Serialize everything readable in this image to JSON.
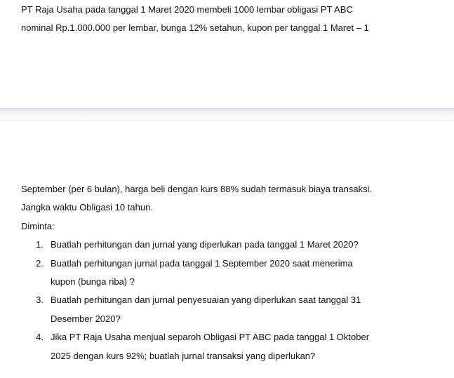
{
  "page1": {
    "line1": "PT Raja Usaha pada tanggal 1 Maret 2020 membeli 1000 lembar obligasi PT ABC",
    "line2": "nominal Rp.1.000.000 per lembar, bunga 12% setahun, kupon per tanggal 1 Maret – 1"
  },
  "page2": {
    "line1": "September (per 6 bulan), harga beli dengan kurs 88% sudah termasuk biaya transaksi.",
    "line2": "Jangka waktu Obligasi 10 tahun.",
    "diminta": "Diminta:",
    "items": [
      {
        "num": "1.",
        "lines": [
          "Buatlah perhitungan dan jurnal yang diperlukan pada tanggal 1 Maret 2020?"
        ]
      },
      {
        "num": "2.",
        "lines": [
          "Buatlah perhitungan jurnal pada tanggal 1 September 2020 saat menerima",
          "kupon (bunga riba) ?"
        ]
      },
      {
        "num": "3.",
        "lines": [
          "Buatlah perhitungan dan jurnal penyesuaian yang diperlukan saat tanggal 31",
          "Desember 2020?"
        ]
      },
      {
        "num": "4.",
        "lines": [
          "Jika PT Raja Usaha menjual separoh Obligasi PT ABC pada tanggal 1 Oktober",
          "2025 dengan kurs 92%; buatlah jurnal transaksi yang diperlukan?"
        ]
      }
    ]
  }
}
